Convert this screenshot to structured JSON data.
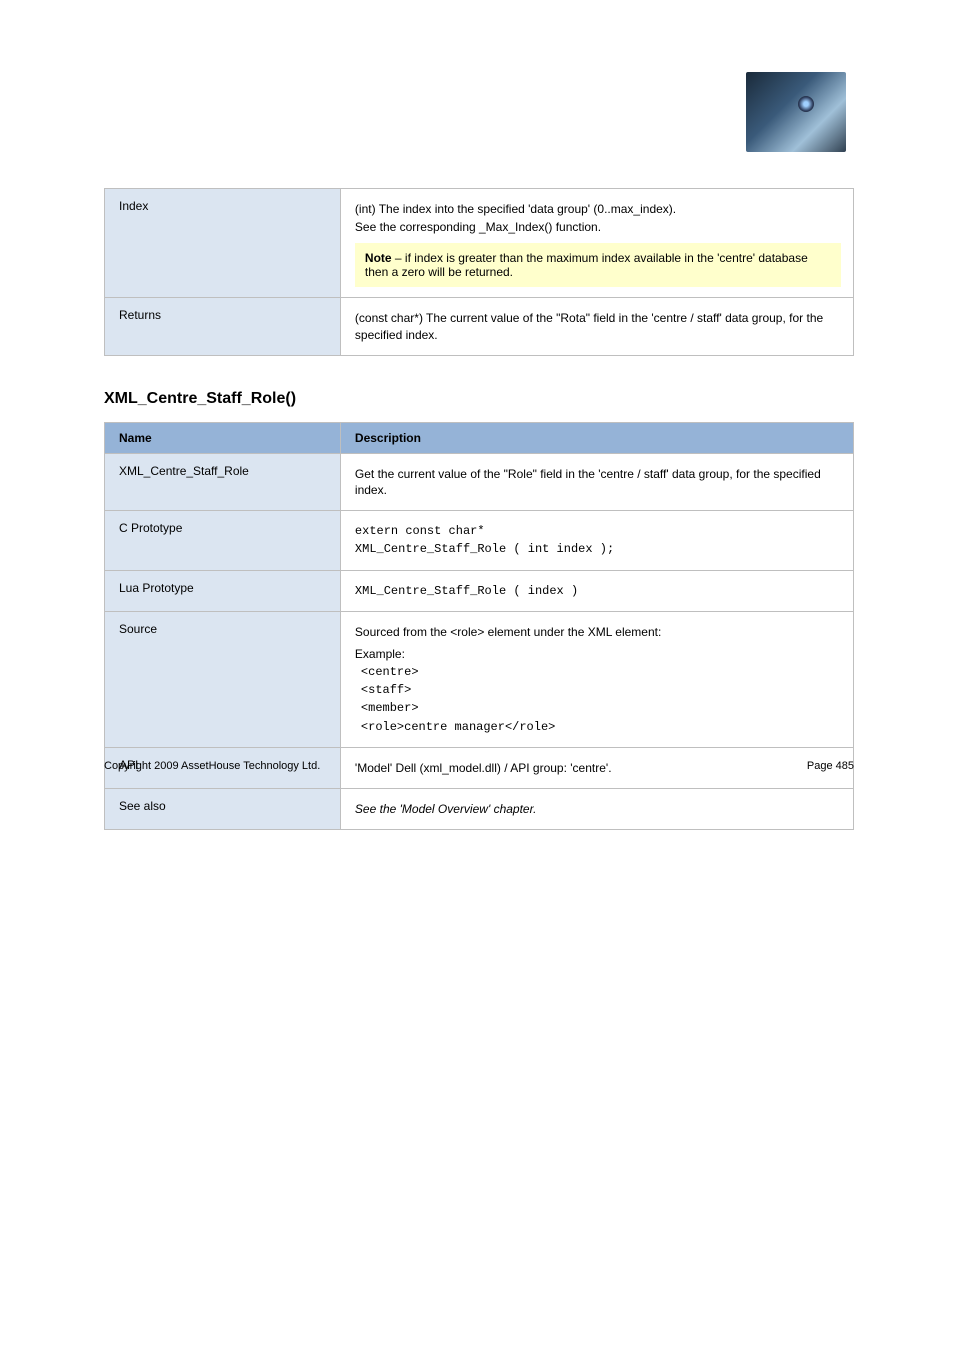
{
  "logo": {
    "alt": "wolf-eye-logo"
  },
  "table1": {
    "rows": [
      {
        "label": "Index",
        "body_lines": [
          "(int) The index into the specified 'data group' (0..max_index).",
          "See the corresponding _Max_Index() function."
        ],
        "note": {
          "title": "Note",
          "text": " – if index is greater than the maximum index available in the 'centre' database then a zero will be returned."
        }
      },
      {
        "label": "Returns",
        "body_lines": [
          "(const char*) The current value of the \"Rota\" field in the 'centre / staff' data group, for the specified index."
        ]
      }
    ]
  },
  "section2": {
    "title": "XML_Centre_Staff_Role()",
    "header": {
      "col1": "Name",
      "col2": "Description"
    },
    "rows": [
      {
        "name": "XML_Centre_Staff_Role",
        "desc_lines": [
          "Get the current value of the \"Role\" field in the 'centre / staff' data group, for the specified index."
        ]
      },
      {
        "name": "C Prototype",
        "is_code": true,
        "desc_lines": [
          "extern const char*",
          "XML_Centre_Staff_Role ( int index );"
        ]
      },
      {
        "name": "Lua Prototype",
        "is_code": true,
        "desc_lines": [
          "XML_Centre_Staff_Role ( index )"
        ]
      },
      {
        "name": "Source",
        "desc_lines": [
          "Sourced from the <role> element under the XML element:"
        ],
        "example_intro": "Example:",
        "example_lines": [
          "<centre>",
          "  <staff>",
          "    <member>",
          "      <role>centre manager</role>"
        ]
      },
      {
        "name": "API",
        "desc_lines": [
          "'Model' Dell (xml_model.dll) / API group: 'centre'."
        ]
      },
      {
        "name": "See also",
        "is_italic": true,
        "desc_lines": [
          "See the 'Model Overview' chapter."
        ]
      }
    ]
  },
  "footer": {
    "left": "Copyright 2009 AssetHouse Technology Ltd.",
    "right": "Page 485"
  }
}
